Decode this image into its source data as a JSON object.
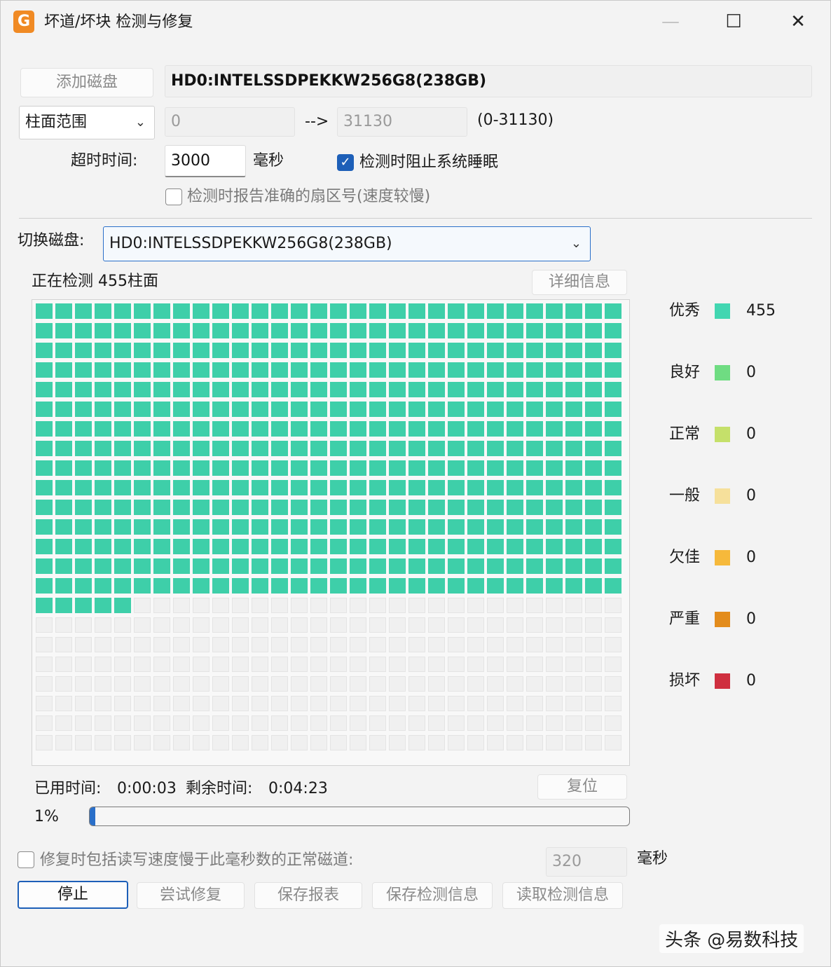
{
  "window": {
    "title": "坏道/坏块 检测与修复",
    "app_icon_glyph": "G",
    "minimize_glyph": "—",
    "maximize_glyph": "☐",
    "close_glyph": "✕"
  },
  "disk": {
    "add_button": "添加磁盘",
    "selected_disk": "HD0:INTELSSDPEKKW256G8(238GB)"
  },
  "range": {
    "mode": "柱面范围",
    "start": "0",
    "arrow": "-->",
    "end": "31130",
    "hint": "(0-31130)"
  },
  "timeout": {
    "label": "超时时间:",
    "value": "3000",
    "unit": "毫秒"
  },
  "options": {
    "prevent_sleep": "检测时阻止系统睡眠",
    "prevent_sleep_checked": true,
    "report_sector": "检测时报告准确的扇区号(速度较慢)",
    "report_sector_checked": false
  },
  "switch_disk": {
    "label": "切换磁盘:",
    "value": "HD0:INTELSSDPEKKW256G8(238GB)"
  },
  "scan": {
    "status": "正在检测 455柱面",
    "details_button": "详细信息",
    "grid_columns": 30,
    "grid_rows": 23,
    "scanned_blocks": 455,
    "scanned_color": "#3ecfa9",
    "empty_color": "#f0f0f0"
  },
  "legend": [
    {
      "label": "优秀",
      "color": "#42d6b1",
      "count": "455"
    },
    {
      "label": "良好",
      "color": "#6fdc82",
      "count": "0"
    },
    {
      "label": "正常",
      "color": "#c5e06a",
      "count": "0"
    },
    {
      "label": "一般",
      "color": "#f6e09b",
      "count": "0"
    },
    {
      "label": "欠佳",
      "color": "#f6b93b",
      "count": "0"
    },
    {
      "label": "严重",
      "color": "#e38c1c",
      "count": "0"
    },
    {
      "label": "损坏",
      "color": "#cf2f3f",
      "count": "0"
    }
  ],
  "timing": {
    "elapsed_label": "已用时间:",
    "elapsed_value": "0:00:03",
    "remaining_label": "剩余时间:",
    "remaining_value": "0:04:23",
    "reset_button": "复位"
  },
  "progress": {
    "text": "1%",
    "fraction": 0.01
  },
  "repair_option": {
    "label": "修复时包括读写速度慢于此毫秒数的正常磁道:",
    "checked": false,
    "value": "320",
    "unit": "毫秒"
  },
  "actions": {
    "stop": "停止",
    "try_repair": "尝试修复",
    "save_report": "保存报表",
    "save_scan_info": "保存检测信息",
    "load_scan_info": "读取检测信息"
  },
  "watermark": "头条 @易数科技"
}
